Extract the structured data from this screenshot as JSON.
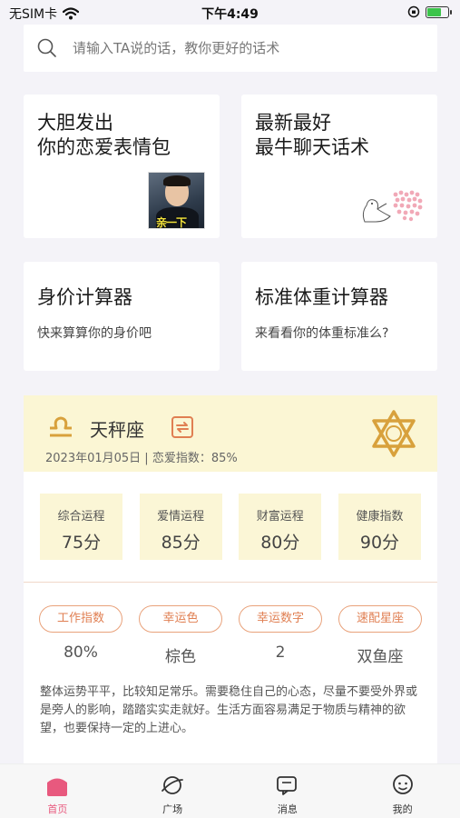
{
  "status_bar": {
    "carrier": "无SIM卡",
    "time": "下午4:49",
    "battery_level": 0.7
  },
  "search": {
    "placeholder": "请输入TA说的话，教你更好的话术",
    "icon": "search-icon"
  },
  "cards": [
    {
      "title_line1": "大胆发出",
      "title_line2": "你的恋爱表情包",
      "sticker_caption": "亲一下",
      "image": "sticker-photo"
    },
    {
      "title_line1": "最新最好",
      "title_line2": "最牛聊天话术",
      "image": "seal-hearts-illustration"
    },
    {
      "title": "身价计算器",
      "subtitle": "快来算算你的身价吧"
    },
    {
      "title": "标准体重计算器",
      "subtitle": "来看看你的体重标准么?"
    }
  ],
  "horoscope": {
    "sign": "天秤座",
    "sign_icon": "libra-icon",
    "switch_icon": "switch-icon",
    "date_text": "2023年01月05日 | 恋爱指数：85%",
    "scores": [
      {
        "label": "综合运程",
        "value": "75分"
      },
      {
        "label": "爱情运程",
        "value": "85分"
      },
      {
        "label": "财富运程",
        "value": "80分"
      },
      {
        "label": "健康指数",
        "value": "90分"
      }
    ],
    "indices": [
      {
        "label": "工作指数",
        "value": "80%"
      },
      {
        "label": "幸运色",
        "value": "棕色"
      },
      {
        "label": "幸运数字",
        "value": "2"
      },
      {
        "label": "速配星座",
        "value": "双鱼座"
      }
    ],
    "description": "整体运势平平，比较知足常乐。需要稳住自己的心态，尽量不要受外界或是旁人的影响，踏踏实实走就好。生活方面容易满足于物质与精神的欲望，也要保持一定的上进心。"
  },
  "tabbar": {
    "tabs": [
      {
        "label": "首页",
        "icon": "home-icon",
        "active": true
      },
      {
        "label": "广场",
        "icon": "planet-icon",
        "active": false
      },
      {
        "label": "消息",
        "icon": "message-icon",
        "active": false
      },
      {
        "label": "我的",
        "icon": "profile-icon",
        "active": false
      }
    ]
  },
  "colors": {
    "accent": "#e8597e",
    "chip_border": "#e9a27b",
    "gold": "#d8a13c",
    "header_bg": "#fbf6d4"
  }
}
